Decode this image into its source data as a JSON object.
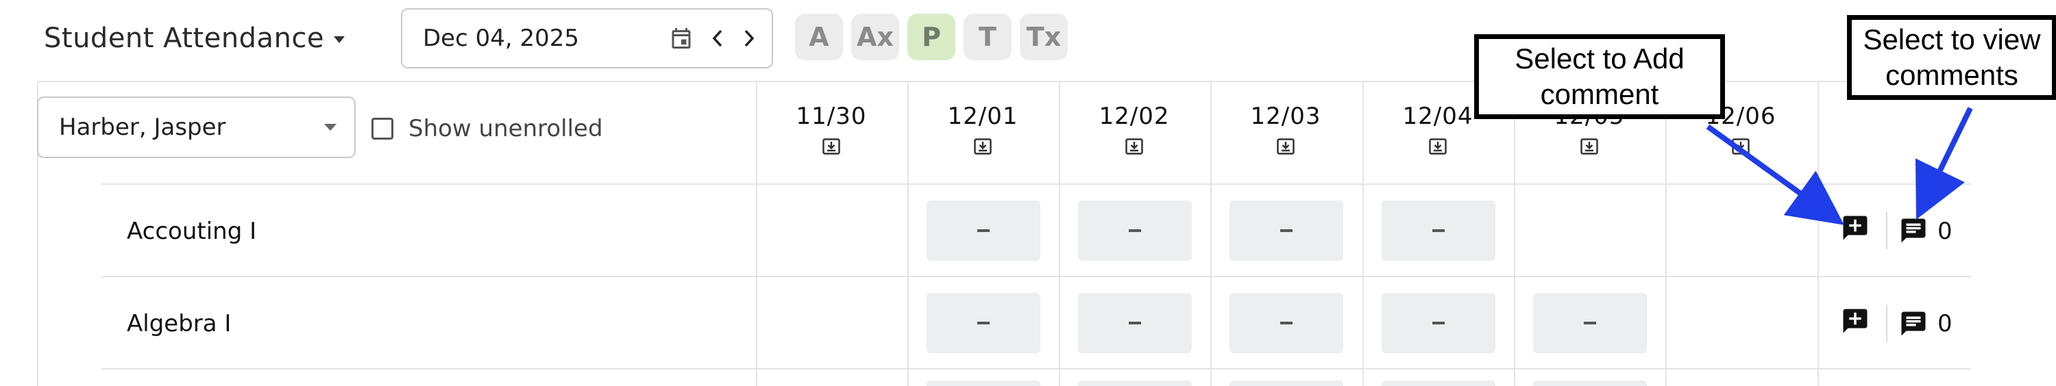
{
  "header": {
    "title": "Student Attendance",
    "date_value": "Dec 04, 2025",
    "status_codes": [
      {
        "label": "A",
        "active": false
      },
      {
        "label": "Ax",
        "active": false
      },
      {
        "label": "P",
        "active": true
      },
      {
        "label": "T",
        "active": false
      },
      {
        "label": "Tx",
        "active": false
      }
    ]
  },
  "filters": {
    "student_selected": "Harber, Jasper",
    "show_unenrolled_label": "Show unenrolled",
    "show_unenrolled_checked": false
  },
  "dates": [
    "11/30",
    "12/01",
    "12/02",
    "12/03",
    "12/04",
    "12/05",
    "12/06"
  ],
  "rows": [
    {
      "course": "Accouting I",
      "cells": [
        "",
        "–",
        "–",
        "–",
        "–",
        "",
        ""
      ],
      "comment_count": "0"
    },
    {
      "course": "Algebra I",
      "cells": [
        "",
        "–",
        "–",
        "–",
        "–",
        "–",
        ""
      ],
      "comment_count": "0"
    }
  ],
  "annotations": {
    "add_comment": "Select to Add comment",
    "view_comments_line1": "Select to view",
    "view_comments_line2": "comments",
    "add_comment_line1": "Select to Add",
    "add_comment_line2": "comment",
    "arrow_color": "#1f3de8"
  },
  "colors": {
    "accent_present": "#d9ecc6",
    "pill_bg": "#ececec",
    "cell_bg": "#eceeef",
    "grid_line": "#e4e4e4"
  }
}
